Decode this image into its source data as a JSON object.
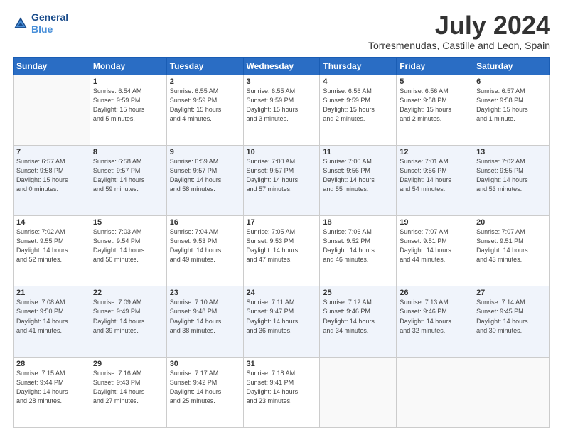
{
  "header": {
    "logo_line1": "General",
    "logo_line2": "Blue",
    "title": "July 2024",
    "subtitle": "Torresmenudas, Castille and Leon, Spain"
  },
  "weekdays": [
    "Sunday",
    "Monday",
    "Tuesday",
    "Wednesday",
    "Thursday",
    "Friday",
    "Saturday"
  ],
  "weeks": [
    [
      {
        "day": "",
        "info": ""
      },
      {
        "day": "1",
        "info": "Sunrise: 6:54 AM\nSunset: 9:59 PM\nDaylight: 15 hours\nand 5 minutes."
      },
      {
        "day": "2",
        "info": "Sunrise: 6:55 AM\nSunset: 9:59 PM\nDaylight: 15 hours\nand 4 minutes."
      },
      {
        "day": "3",
        "info": "Sunrise: 6:55 AM\nSunset: 9:59 PM\nDaylight: 15 hours\nand 3 minutes."
      },
      {
        "day": "4",
        "info": "Sunrise: 6:56 AM\nSunset: 9:59 PM\nDaylight: 15 hours\nand 2 minutes."
      },
      {
        "day": "5",
        "info": "Sunrise: 6:56 AM\nSunset: 9:58 PM\nDaylight: 15 hours\nand 2 minutes."
      },
      {
        "day": "6",
        "info": "Sunrise: 6:57 AM\nSunset: 9:58 PM\nDaylight: 15 hours\nand 1 minute."
      }
    ],
    [
      {
        "day": "7",
        "info": "Sunrise: 6:57 AM\nSunset: 9:58 PM\nDaylight: 15 hours\nand 0 minutes."
      },
      {
        "day": "8",
        "info": "Sunrise: 6:58 AM\nSunset: 9:57 PM\nDaylight: 14 hours\nand 59 minutes."
      },
      {
        "day": "9",
        "info": "Sunrise: 6:59 AM\nSunset: 9:57 PM\nDaylight: 14 hours\nand 58 minutes."
      },
      {
        "day": "10",
        "info": "Sunrise: 7:00 AM\nSunset: 9:57 PM\nDaylight: 14 hours\nand 57 minutes."
      },
      {
        "day": "11",
        "info": "Sunrise: 7:00 AM\nSunset: 9:56 PM\nDaylight: 14 hours\nand 55 minutes."
      },
      {
        "day": "12",
        "info": "Sunrise: 7:01 AM\nSunset: 9:56 PM\nDaylight: 14 hours\nand 54 minutes."
      },
      {
        "day": "13",
        "info": "Sunrise: 7:02 AM\nSunset: 9:55 PM\nDaylight: 14 hours\nand 53 minutes."
      }
    ],
    [
      {
        "day": "14",
        "info": "Sunrise: 7:02 AM\nSunset: 9:55 PM\nDaylight: 14 hours\nand 52 minutes."
      },
      {
        "day": "15",
        "info": "Sunrise: 7:03 AM\nSunset: 9:54 PM\nDaylight: 14 hours\nand 50 minutes."
      },
      {
        "day": "16",
        "info": "Sunrise: 7:04 AM\nSunset: 9:53 PM\nDaylight: 14 hours\nand 49 minutes."
      },
      {
        "day": "17",
        "info": "Sunrise: 7:05 AM\nSunset: 9:53 PM\nDaylight: 14 hours\nand 47 minutes."
      },
      {
        "day": "18",
        "info": "Sunrise: 7:06 AM\nSunset: 9:52 PM\nDaylight: 14 hours\nand 46 minutes."
      },
      {
        "day": "19",
        "info": "Sunrise: 7:07 AM\nSunset: 9:51 PM\nDaylight: 14 hours\nand 44 minutes."
      },
      {
        "day": "20",
        "info": "Sunrise: 7:07 AM\nSunset: 9:51 PM\nDaylight: 14 hours\nand 43 minutes."
      }
    ],
    [
      {
        "day": "21",
        "info": "Sunrise: 7:08 AM\nSunset: 9:50 PM\nDaylight: 14 hours\nand 41 minutes."
      },
      {
        "day": "22",
        "info": "Sunrise: 7:09 AM\nSunset: 9:49 PM\nDaylight: 14 hours\nand 39 minutes."
      },
      {
        "day": "23",
        "info": "Sunrise: 7:10 AM\nSunset: 9:48 PM\nDaylight: 14 hours\nand 38 minutes."
      },
      {
        "day": "24",
        "info": "Sunrise: 7:11 AM\nSunset: 9:47 PM\nDaylight: 14 hours\nand 36 minutes."
      },
      {
        "day": "25",
        "info": "Sunrise: 7:12 AM\nSunset: 9:46 PM\nDaylight: 14 hours\nand 34 minutes."
      },
      {
        "day": "26",
        "info": "Sunrise: 7:13 AM\nSunset: 9:46 PM\nDaylight: 14 hours\nand 32 minutes."
      },
      {
        "day": "27",
        "info": "Sunrise: 7:14 AM\nSunset: 9:45 PM\nDaylight: 14 hours\nand 30 minutes."
      }
    ],
    [
      {
        "day": "28",
        "info": "Sunrise: 7:15 AM\nSunset: 9:44 PM\nDaylight: 14 hours\nand 28 minutes."
      },
      {
        "day": "29",
        "info": "Sunrise: 7:16 AM\nSunset: 9:43 PM\nDaylight: 14 hours\nand 27 minutes."
      },
      {
        "day": "30",
        "info": "Sunrise: 7:17 AM\nSunset: 9:42 PM\nDaylight: 14 hours\nand 25 minutes."
      },
      {
        "day": "31",
        "info": "Sunrise: 7:18 AM\nSunset: 9:41 PM\nDaylight: 14 hours\nand 23 minutes."
      },
      {
        "day": "",
        "info": ""
      },
      {
        "day": "",
        "info": ""
      },
      {
        "day": "",
        "info": ""
      }
    ]
  ]
}
